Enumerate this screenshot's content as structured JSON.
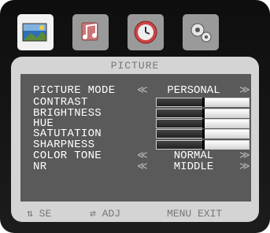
{
  "tabs": [
    {
      "icon": "picture-icon",
      "selected": true
    },
    {
      "icon": "music-icon",
      "selected": false
    },
    {
      "icon": "clock-icon",
      "selected": false
    },
    {
      "icon": "gear-icon",
      "selected": false
    }
  ],
  "menu": {
    "title": "PICTURE",
    "items": [
      {
        "label": "PICTURE MODE",
        "value": "PERSONAL"
      },
      {
        "label": "CONTRAST",
        "level": 0.5
      },
      {
        "label": "BRIGHTNESS",
        "level": 0.5
      },
      {
        "label": "HUE",
        "level": 0.5
      },
      {
        "label": "SATUTATION",
        "level": 0.5
      },
      {
        "label": "SHARPNESS",
        "level": 0.5
      },
      {
        "label": "COLOR TONE",
        "value": "NORMAL"
      },
      {
        "label": "NR",
        "value": "MIDDLE"
      }
    ]
  },
  "footer": {
    "select": "SE",
    "adjust": "ADJ",
    "exit": "MENU EXIT"
  }
}
